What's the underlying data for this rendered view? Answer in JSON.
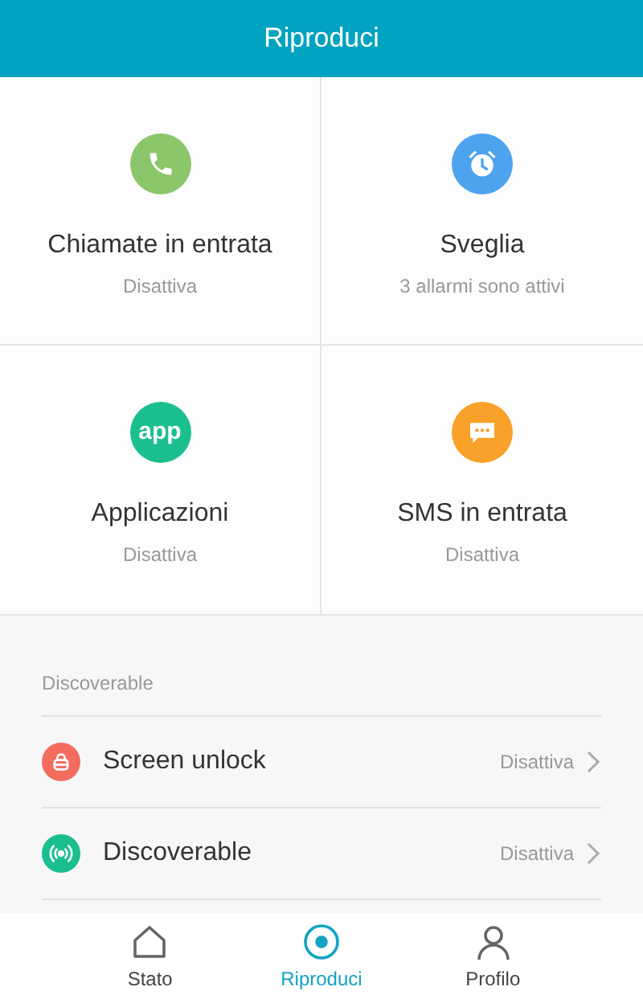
{
  "header": {
    "title": "Riproduci"
  },
  "tiles": [
    {
      "kind": "phone",
      "color": "#8cc66a",
      "title": "Chiamate in entrata",
      "status": "Disattiva"
    },
    {
      "kind": "alarm",
      "color": "#4ea3ef",
      "title": "Sveglia",
      "status": "3 allarmi sono attivi"
    },
    {
      "kind": "app",
      "color": "#1bbf8f",
      "icon_text": "app",
      "title": "Applicazioni",
      "status": "Disattiva"
    },
    {
      "kind": "message",
      "color": "#f9a128",
      "title": "SMS in entrata",
      "status": "Disattiva"
    }
  ],
  "section": {
    "title": "Discoverable",
    "items": [
      {
        "kind": "lock",
        "color": "#f36c5e",
        "label": "Screen unlock",
        "value": "Disattiva"
      },
      {
        "kind": "signal",
        "color": "#1bbf8f",
        "label": "Discoverable",
        "value": "Disattiva"
      }
    ]
  },
  "nav": [
    {
      "kind": "home",
      "label": "Stato",
      "selected": false
    },
    {
      "kind": "target",
      "label": "Riproduci",
      "selected": true
    },
    {
      "kind": "person",
      "label": "Profilo",
      "selected": false
    }
  ]
}
